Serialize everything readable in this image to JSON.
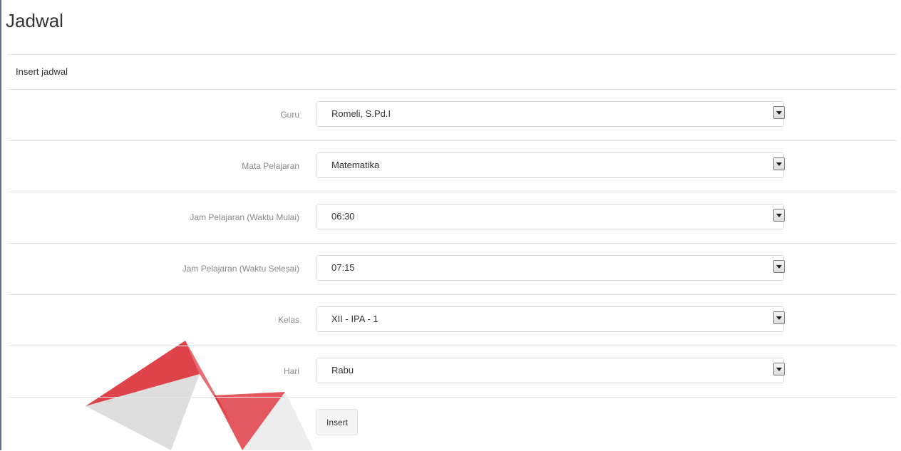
{
  "page": {
    "title": "Jadwal"
  },
  "panel": {
    "heading": "Insert jadwal"
  },
  "form": {
    "fields": [
      {
        "label": "Guru",
        "value": "Romeli, S.Pd.I"
      },
      {
        "label": "Mata Pelajaran",
        "value": "Matematika"
      },
      {
        "label": "Jam Pelajaran (Waktu Mulai)",
        "value": "06:30"
      },
      {
        "label": "Jam Pelajaran (Waktu Selesai)",
        "value": "07:15"
      },
      {
        "label": "Kelas",
        "value": "XII - IPA - 1"
      },
      {
        "label": "Hari",
        "value": "Rabu"
      }
    ],
    "submit_label": "Insert"
  },
  "colors": {
    "watermark_red": "#d9222a",
    "watermark_gray": "#c8c8c8",
    "border": "#e6e6e6"
  }
}
